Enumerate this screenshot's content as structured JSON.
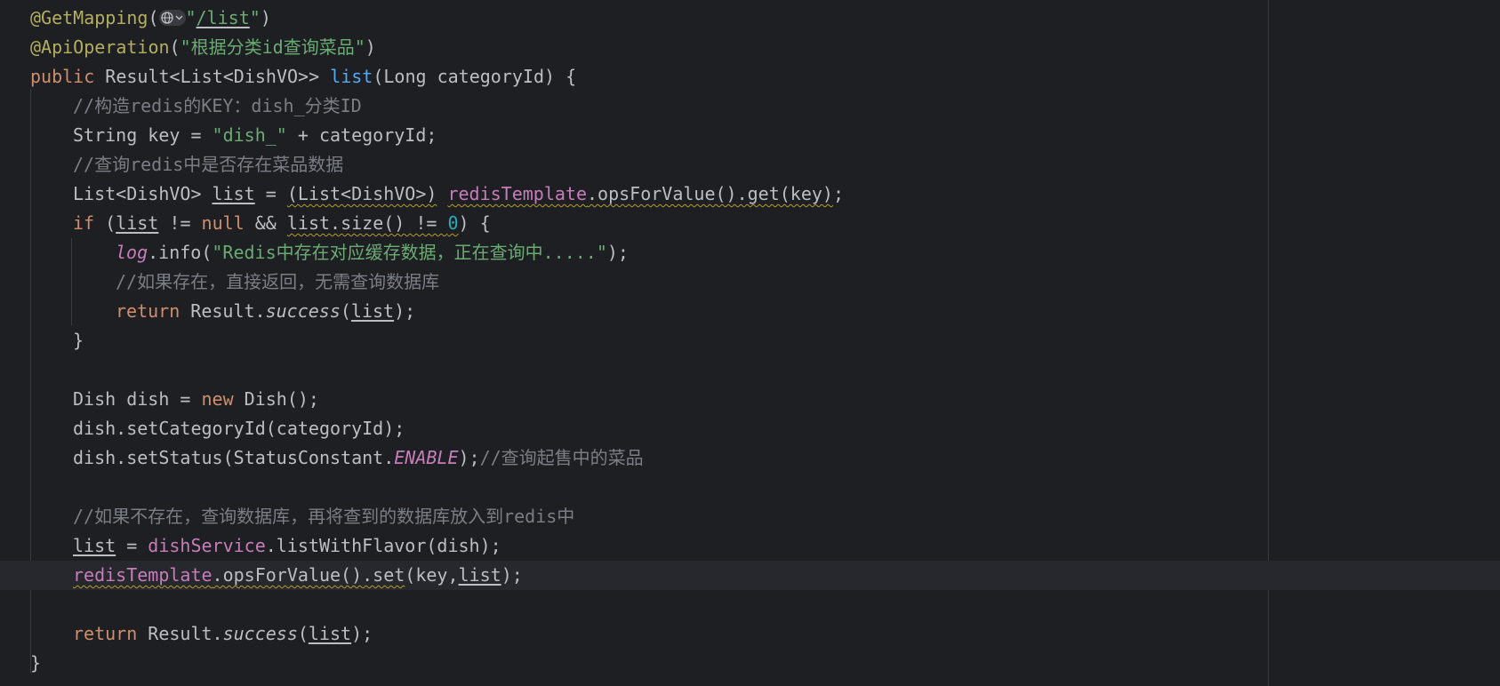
{
  "code": {
    "l1": {
      "annotation": "@GetMapping",
      "open": "(",
      "q1": "\"",
      "path": "/list",
      "q2": "\"",
      "close": ")"
    },
    "l2": {
      "annotation": "@ApiOperation",
      "open": "(",
      "str": "\"根据分类id查询菜品\"",
      "close": ")"
    },
    "l3": {
      "kw": "public",
      "type": " Result<List<DishVO>> ",
      "method": "list",
      "params": "(Long categoryId) {"
    },
    "l4": {
      "comment": "//构造redis的KEY：dish_分类ID"
    },
    "l5": {
      "pre": "String key = ",
      "str": "\"dish_\"",
      "post": " + categoryId;"
    },
    "l6": {
      "comment": "//查询redis中是否存在菜品数据"
    },
    "l7": {
      "pre": "List<DishVO> ",
      "var": "list",
      "eq": " = ",
      "cast": "(List<DishVO>)",
      "sp": " ",
      "field": "redisTemplate",
      "call": ".opsForValue().get(key)",
      "end": ";"
    },
    "l8": {
      "kw": "if",
      "p1": " (",
      "var1": "list",
      "op1": " != ",
      "null": "null",
      "op2": " && ",
      "call": "list.size() != ",
      "num": "0",
      "end": ") {"
    },
    "l9": {
      "field": "log",
      "pre": ".info(",
      "str": "\"Redis中存在对应缓存数据，正在查询中.....\"",
      "end": ");"
    },
    "l10": {
      "comment": "//如果存在，直接返回，无需查询数据库"
    },
    "l11": {
      "kw": "return",
      "pre": " Result.",
      "method": "success",
      "p1": "(",
      "var": "list",
      "end": ");"
    },
    "l12": {
      "text": "}"
    },
    "l14": {
      "pre": "Dish dish = ",
      "kw": "new",
      "post": " Dish();"
    },
    "l15": {
      "text": "dish.setCategoryId(categoryId);"
    },
    "l16": {
      "pre": "dish.setStatus(StatusConstant.",
      "const": "ENABLE",
      "end": ");",
      "comment": "//查询起售中的菜品"
    },
    "l18": {
      "comment": "//如果不存在，查询数据库，再将查到的数据库放入到redis中"
    },
    "l19": {
      "var": "list",
      "eq": " = ",
      "field": "dishService",
      "call": ".listWithFlavor(dish);"
    },
    "l20": {
      "field": "redisTemplate",
      "call": ".opsForValue().set",
      "args1": "(key,",
      "var": "list",
      "end": ");"
    },
    "l22": {
      "kw": "return",
      "pre": " Result.",
      "method": "success",
      "p1": "(",
      "var": "list",
      "end": ");"
    },
    "l23": {
      "text": "}"
    }
  },
  "colors": {
    "background": "#1e1f22",
    "current_line": "#26282e",
    "keyword": "#cf8e6d",
    "annotation": "#b3ae60",
    "string": "#6aab73",
    "comment": "#7a7e85",
    "field": "#c77dbb",
    "method_decl": "#56a8f5",
    "number": "#2aacb8",
    "warning_underline": "#b59d2a"
  },
  "icons": {
    "endpoint": "globe-icon",
    "dropdown": "chevron-down-icon"
  }
}
